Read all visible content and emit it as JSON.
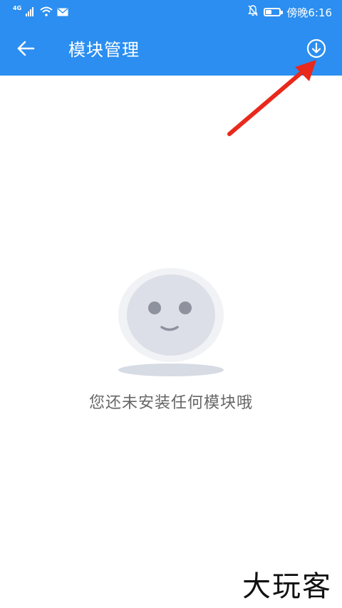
{
  "status_bar": {
    "network_label": "4G",
    "time": "傍晚6:16",
    "battery_level": 0.45,
    "icons": [
      "signal-icon",
      "wifi-icon",
      "mail-icon",
      "notifications-muted-icon",
      "battery-icon"
    ]
  },
  "app_bar": {
    "title": "模块管理",
    "back_icon": "back-arrow-icon",
    "action_icon": "download-icon",
    "color": "#2b8ef0"
  },
  "empty_state": {
    "message": "您还未安装任何模块哦",
    "illustration": "smiling-face-illustration"
  },
  "annotation": {
    "arrow_color": "#e8291c"
  },
  "watermark": {
    "text": "大玩客"
  }
}
